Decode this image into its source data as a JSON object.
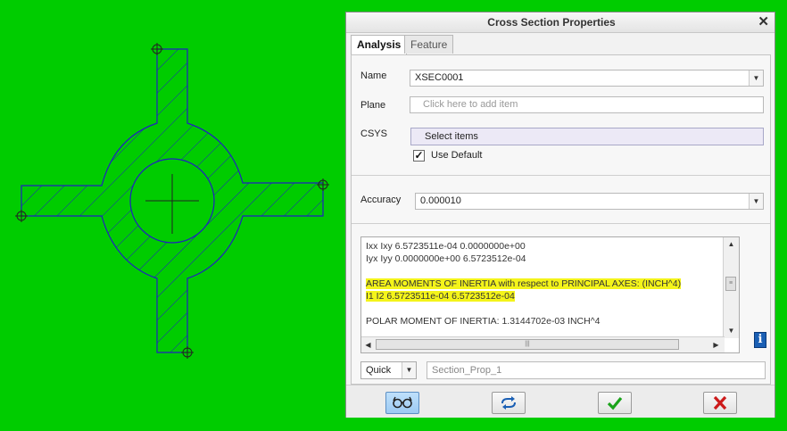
{
  "dialog": {
    "title": "Cross Section Properties",
    "close_glyph": "✕",
    "tabs": [
      {
        "label": "Analysis",
        "active": true
      },
      {
        "label": "Feature",
        "active": false
      }
    ]
  },
  "form": {
    "name_label": "Name",
    "name_value": "XSEC0001",
    "plane_label": "Plane",
    "plane_placeholder": "Click here to add item",
    "csys_label": "CSYS",
    "csys_value": "Select items",
    "use_default_label": "Use Default",
    "use_default_checked": true,
    "accuracy_label": "Accuracy",
    "accuracy_value": "0.000010"
  },
  "results": {
    "lines": [
      "Ixx Ixy  6.5723511e-04  0.0000000e+00",
      "Iyx Iyy  0.0000000e+00  6.5723512e-04",
      "",
      "AREA MOMENTS OF INERTIA with respect to PRINCIPAL AXES:  (INCH^4)",
      "I1  I2  6.5723511e-04  6.5723512e-04",
      "",
      "POLAR MOMENT OF INERTIA:  1.3144702e-03 INCH^4"
    ]
  },
  "footer": {
    "quick_value": "Quick",
    "name_placeholder": "Section_Prop_1"
  },
  "colors": {
    "background": "#00cc00",
    "section_outline": "#2020c0",
    "highlight": "#f4f41a",
    "ok_green": "#1aa31a",
    "cancel_red": "#cc1a1a"
  },
  "icons": [
    "close-icon",
    "dropdown-arrow-icon",
    "checkbox-icon",
    "info-icon",
    "glasses-icon",
    "repeat-icon",
    "checkmark-icon",
    "x-icon"
  ]
}
